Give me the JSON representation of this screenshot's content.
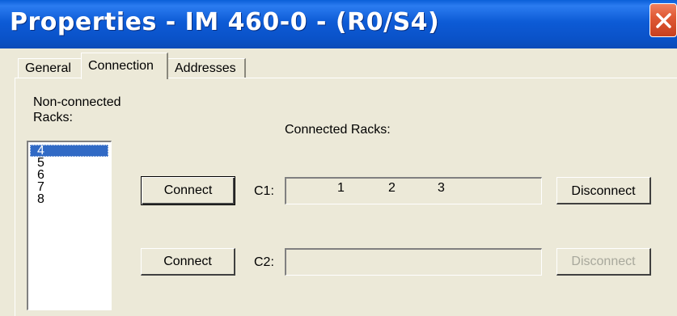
{
  "window": {
    "title": "Properties - IM 460-0 - (R0/S4)",
    "close_icon": "close-icon"
  },
  "tabs": [
    {
      "label": "General",
      "active": false
    },
    {
      "label": "Connection",
      "active": true
    },
    {
      "label": "Addresses",
      "active": false
    }
  ],
  "non_connected": {
    "label_line1": "Non-connected",
    "label_line2": "Racks:",
    "items": [
      "4",
      "5",
      "6",
      "7",
      "8"
    ],
    "selected": "4"
  },
  "connected": {
    "label": "Connected Racks:",
    "c1": {
      "label": "C1:",
      "connect_label": "Connect",
      "disconnect_label": "Disconnect",
      "racks": [
        "1",
        "2",
        "3"
      ]
    },
    "c2": {
      "label": "C2:",
      "connect_label": "Connect",
      "disconnect_label": "Disconnect",
      "racks": []
    }
  },
  "colors": {
    "titlebar": "#0a52c8",
    "selection": "#316ac5",
    "face": "#ece9d8",
    "close": "#e05a35"
  }
}
